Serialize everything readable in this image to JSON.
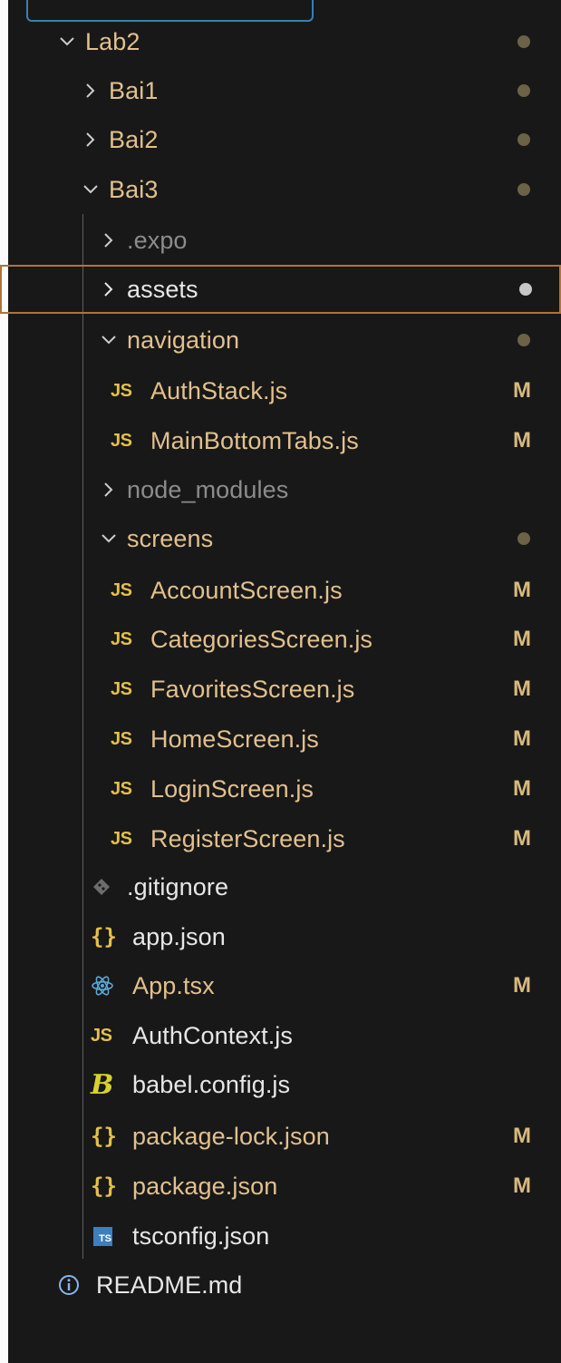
{
  "explorer": {
    "items": [
      {
        "label": "Lab2",
        "type": "folder",
        "expanded": true,
        "depth": 0,
        "dot": true
      },
      {
        "label": "Bai1",
        "type": "folder",
        "expanded": false,
        "depth": 1,
        "dot": true
      },
      {
        "label": "Bai2",
        "type": "folder",
        "expanded": false,
        "depth": 1,
        "dot": true
      },
      {
        "label": "Bai3",
        "type": "folder",
        "expanded": true,
        "depth": 1,
        "dot": true
      },
      {
        "label": ".expo",
        "type": "folder",
        "expanded": false,
        "depth": 2
      },
      {
        "label": "assets",
        "type": "folder",
        "expanded": false,
        "depth": 2,
        "dot": true,
        "focused": true
      },
      {
        "label": "navigation",
        "type": "folder",
        "expanded": true,
        "depth": 2,
        "dot": true
      },
      {
        "label": "AuthStack.js",
        "type": "js",
        "depth": 3,
        "badge": "M"
      },
      {
        "label": "MainBottomTabs.js",
        "type": "js",
        "depth": 3,
        "badge": "M"
      },
      {
        "label": "node_modules",
        "type": "folder",
        "expanded": false,
        "depth": 2
      },
      {
        "label": "screens",
        "type": "folder",
        "expanded": true,
        "depth": 2,
        "dot": true
      },
      {
        "label": "AccountScreen.js",
        "type": "js",
        "depth": 3,
        "badge": "M"
      },
      {
        "label": "CategoriesScreen.js",
        "type": "js",
        "depth": 3,
        "badge": "M"
      },
      {
        "label": "FavoritesScreen.js",
        "type": "js",
        "depth": 3,
        "badge": "M"
      },
      {
        "label": "HomeScreen.js",
        "type": "js",
        "depth": 3,
        "badge": "M"
      },
      {
        "label": "LoginScreen.js",
        "type": "js",
        "depth": 3,
        "badge": "M"
      },
      {
        "label": "RegisterScreen.js",
        "type": "js",
        "depth": 3,
        "badge": "M"
      },
      {
        "label": ".gitignore",
        "type": "gitignore",
        "depth": 2
      },
      {
        "label": "app.json",
        "type": "json",
        "depth": 2
      },
      {
        "label": "App.tsx",
        "type": "react",
        "depth": 2,
        "badge": "M"
      },
      {
        "label": "AuthContext.js",
        "type": "js",
        "depth": 2
      },
      {
        "label": "babel.config.js",
        "type": "babel",
        "depth": 2
      },
      {
        "label": "package-lock.json",
        "type": "json",
        "depth": 2,
        "badge": "M"
      },
      {
        "label": "package.json",
        "type": "json",
        "depth": 2,
        "badge": "M"
      },
      {
        "label": "tsconfig.json",
        "type": "ts",
        "depth": 2
      },
      {
        "label": "README.md",
        "type": "info",
        "depth": 1
      }
    ],
    "icon_text": {
      "js": "JS",
      "json": "{}",
      "ts": "TS"
    },
    "colors": {
      "background": "#181818",
      "modified": "#e2c08d",
      "folder_text": "#cccccc",
      "ignored": "#8c8c8c",
      "focus_border": "#b77133",
      "js_icon": "#e4c04a"
    }
  }
}
